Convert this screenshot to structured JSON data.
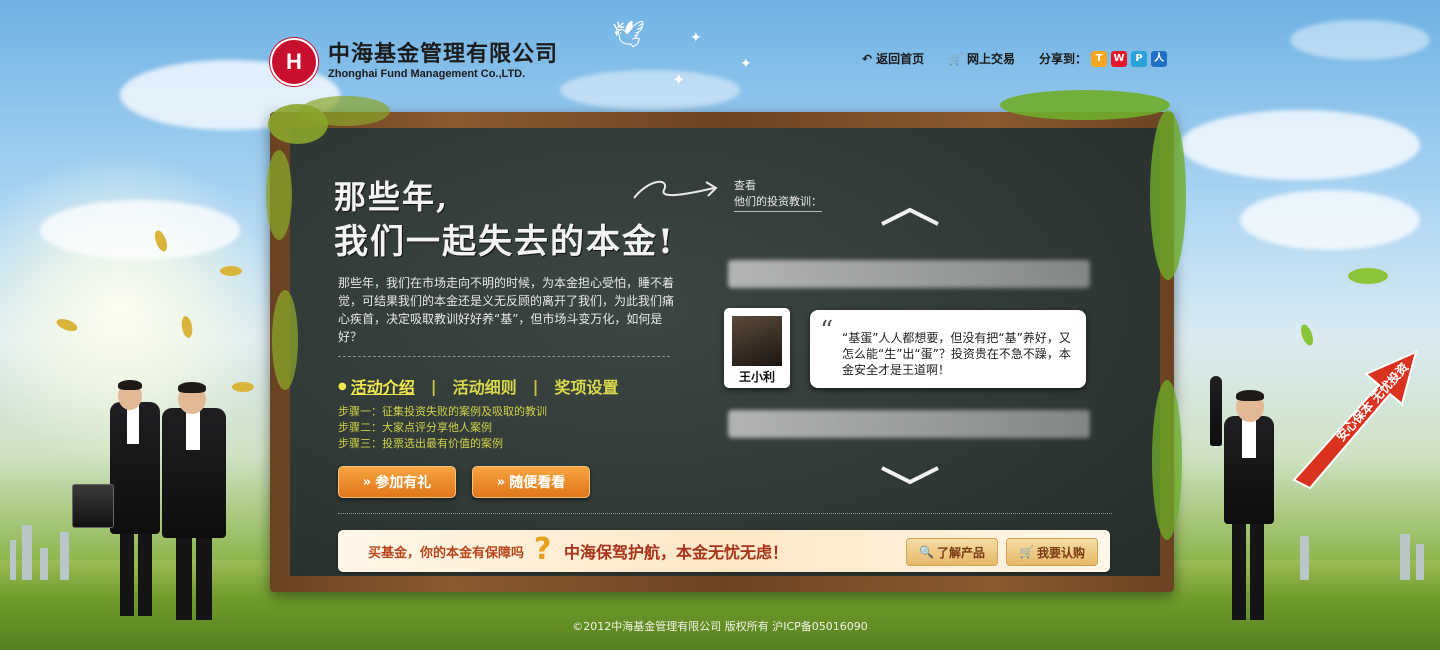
{
  "header": {
    "logo_mark": "H",
    "company_cn": "中海基金管理有限公司",
    "company_en": "Zhonghai Fund Management Co.,LTD.",
    "nav": [
      {
        "label": "返回首页",
        "icon": "back-arrow-icon"
      },
      {
        "label": "网上交易",
        "icon": "cart-icon"
      }
    ],
    "share_label": "分享到：",
    "share_icons": [
      {
        "name": "tencent-weibo-icon",
        "glyph": "T",
        "color": "#f5a623"
      },
      {
        "name": "sina-weibo-icon",
        "glyph": "W",
        "color": "#e6162d"
      },
      {
        "name": "qzone-icon",
        "glyph": "P",
        "color": "#2aa3d8"
      },
      {
        "name": "renren-icon",
        "glyph": "人",
        "color": "#1f6fc5"
      }
    ]
  },
  "board": {
    "title_line1": "那些年,",
    "title_line2": "我们一起失去的本金!",
    "intro": "那些年，我们在市场走向不明的时候，为本金担心受怕，睡不着觉，可结果我们的本金还是义无反顾的离开了我们，为此我们痛心疾首，决定吸取教训好好养“基”，但市场斗变万化，如何是好？",
    "tabs": [
      "活动介绍",
      "活动细则",
      "奖项设置"
    ],
    "steps": [
      "步骤一：征集投资失败的案例及吸取的教训",
      "步骤二：大家点评分享他人案例",
      "步骤三：投票选出最有价值的案例"
    ],
    "buttons": {
      "join": "参加有礼",
      "browse": "随便看看"
    },
    "check_line1": "查看",
    "check_line2": "他们的投资教训："
  },
  "testimonial": {
    "name": "王小利",
    "quote": "“基蛋”人人都想要，但没有把“基”养好，又怎么能“生”出“蛋”？投资贵在不急不躁，本金安全才是王道啊！"
  },
  "banner": {
    "text1": "买基金，你的本金有保障吗",
    "question": "?",
    "text2": "中海保驾护航，本金无忧无虑！",
    "btn_learn": "了解产品",
    "btn_buy": "我要认购"
  },
  "arrow_text": "安心保本 无忧投资",
  "footer": "©2012中海基金管理有限公司 版权所有 沪ICP备05016090",
  "colors": {
    "board": "#2f3835",
    "frame": "#7a4c28",
    "accent_orange": "#e0761a",
    "tab_yellow": "#f2e94e",
    "brand_red": "#c8102e"
  }
}
